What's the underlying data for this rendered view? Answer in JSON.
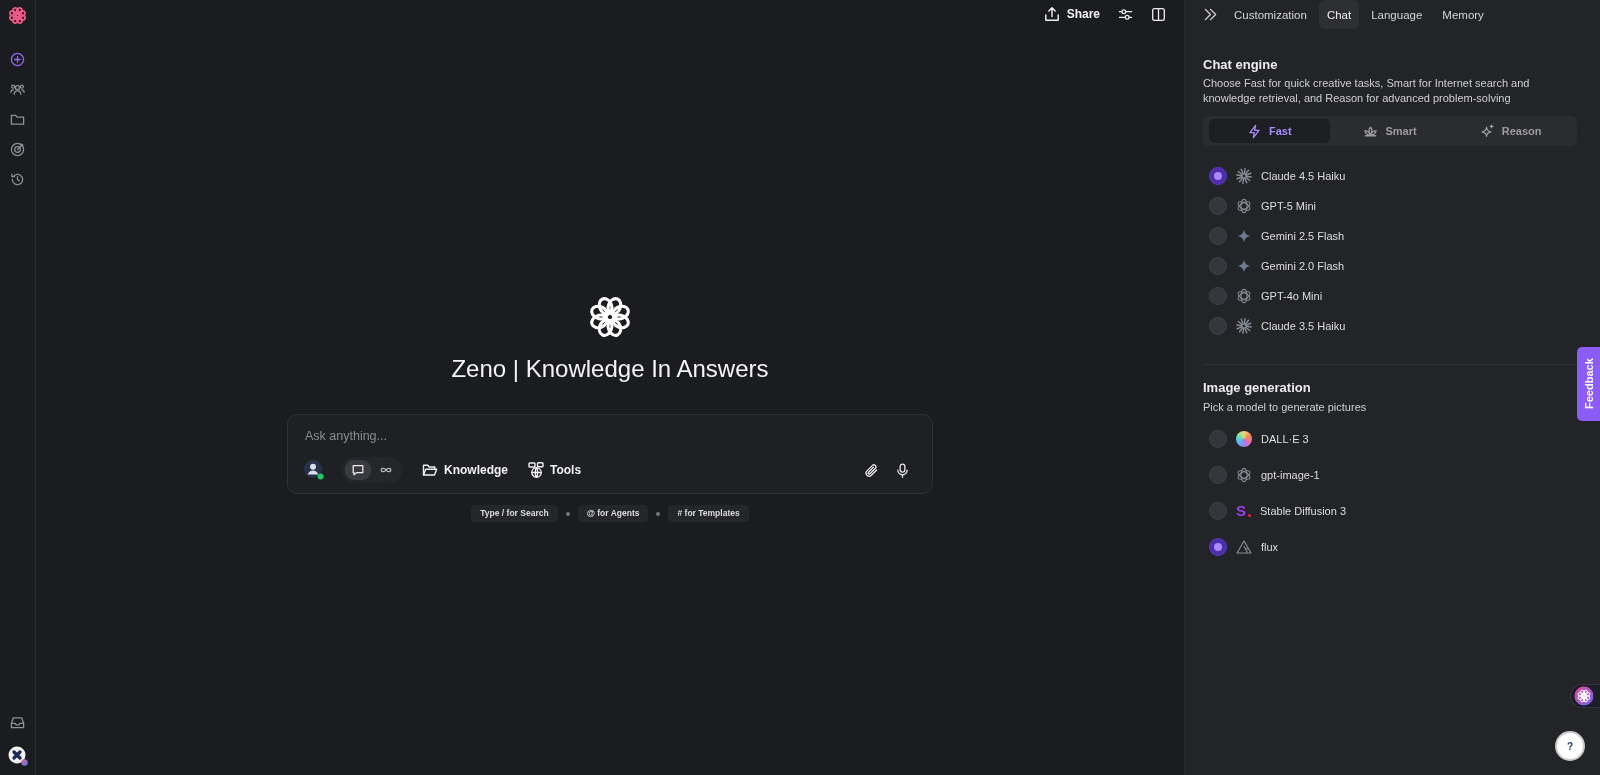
{
  "topbar": {
    "share": "Share"
  },
  "hero": {
    "title": "Zeno | Knowledge In Answers"
  },
  "composer": {
    "placeholder": "Ask anything...",
    "modes": [
      {
        "kind": "chat",
        "selected": true
      },
      {
        "kind": "loop",
        "selected": false
      }
    ],
    "actions": [
      {
        "kind": "folder",
        "label": "Knowledge"
      },
      {
        "kind": "globe",
        "label": "Tools"
      }
    ]
  },
  "hints": [
    "Type / for Search",
    "@ for Agents",
    "# for Templates"
  ],
  "settings": {
    "tabs": [
      {
        "label": "Customization",
        "selected": false
      },
      {
        "label": "Chat",
        "selected": true
      },
      {
        "label": "Language",
        "selected": false
      },
      {
        "label": "Memory",
        "selected": false
      }
    ],
    "chat_engine": {
      "title": "Chat engine",
      "description": "Choose Fast for quick creative tasks, Smart for Internet search and knowledge retrieval, and Reason for advanced problem-solving",
      "modes": [
        {
          "kind": "fast",
          "label": "Fast",
          "selected": true
        },
        {
          "kind": "smart",
          "label": "Smart",
          "selected": false
        },
        {
          "kind": "reason",
          "label": "Reason",
          "selected": false
        }
      ],
      "models": [
        {
          "kind": "claude",
          "name": "Claude 4.5 Haiku",
          "selected": true
        },
        {
          "kind": "openai",
          "name": "GPT-5 Mini",
          "selected": false
        },
        {
          "kind": "gemini",
          "name": "Gemini 2.5 Flash",
          "selected": false
        },
        {
          "kind": "gemini",
          "name": "Gemini 2.0 Flash",
          "selected": false
        },
        {
          "kind": "openai",
          "name": "GPT-4o Mini",
          "selected": false
        },
        {
          "kind": "claude",
          "name": "Claude 3.5 Haiku",
          "selected": false
        }
      ]
    },
    "image_generation": {
      "title": "Image generation",
      "description": "Pick a model to generate pictures",
      "models": [
        {
          "kind": "dalle",
          "name": "DALL·E 3",
          "selected": false
        },
        {
          "kind": "openai",
          "name": "gpt-image-1",
          "selected": false
        },
        {
          "kind": "letter",
          "glyph": "S",
          "name": "Stable Diffusion 3",
          "selected": false
        },
        {
          "kind": "flux",
          "name": "flux",
          "selected": true
        }
      ]
    }
  },
  "feedback": "Feedback",
  "help": "?"
}
